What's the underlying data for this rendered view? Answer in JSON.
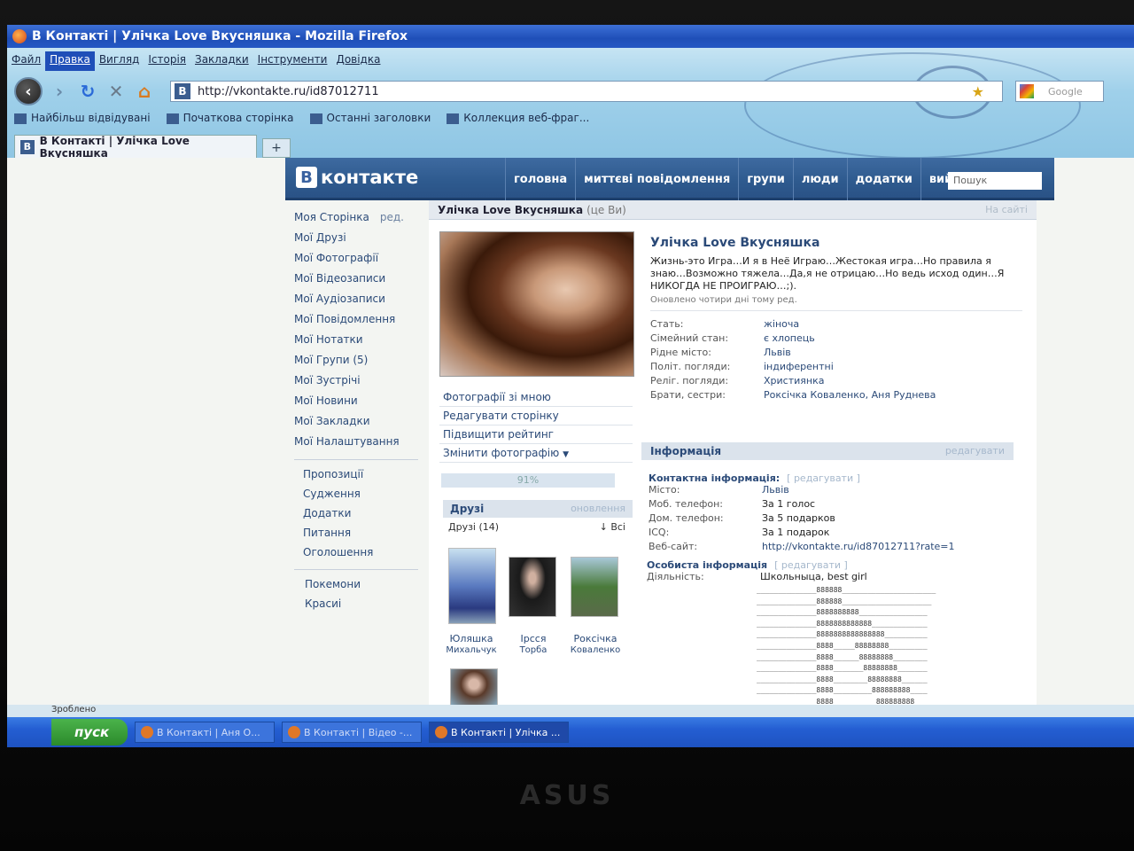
{
  "window": {
    "title": "В Контакті | Улічка Love Вкусняшка - Mozilla Firefox"
  },
  "menu": [
    "Файл",
    "Правка",
    "Вигляд",
    "Історія",
    "Закладки",
    "Інструменти",
    "Довідка"
  ],
  "url": "http://vkontakte.ru/id87012711",
  "search_placeholder": "Google",
  "bookmarks": [
    "Найбільш відвідувані",
    "Початкова сторінка",
    "Останні заголовки",
    "Коллекция веб-фраг..."
  ],
  "tab": {
    "label": "В Контакті | Улічка Love Вкусняшка",
    "new_tab": "+"
  },
  "vk": {
    "logo": "контакте",
    "logo_letter": "В",
    "nav": [
      "головна",
      "миттєві повідомлення",
      "групи",
      "люди",
      "додатки",
      "вийти"
    ],
    "search_placeholder": "Пошук"
  },
  "leftmenu": {
    "my_page": "Моя Сторінка",
    "edit": "ред.",
    "items": [
      "Мої Друзі",
      "Мої Фотографії",
      "Мої Відеозаписи",
      "Мої Аудіозаписи",
      "Мої Повідомлення",
      "Мої Нотатки",
      "Мої Групи (5)",
      "Мої Зустрічі",
      "Мої Новини",
      "Мої Закладки",
      "Мої Налаштування"
    ],
    "items2": [
      "Пропозиції",
      "Судження",
      "Додатки",
      "Питання",
      "Оголошення"
    ],
    "items3": [
      "Покемони",
      "Красиі"
    ]
  },
  "profile": {
    "header_name": "Улічка Love Вкусняшка",
    "header_me": "(це Ви)",
    "online": "На сайті",
    "name": "Улічка Love Вкусняшка",
    "status": "Жизнь-это Игра…И я в Неё Играю…Жестокая игра…Но правила я знаю…Возможно тяжела…Да,я не отрицаю…Но ведь исход один…Я НИКОГДА НЕ ПРОИГРАЮ…;).",
    "updated": "Оновлено чотири дні тому ред.",
    "fields": [
      {
        "k": "Стать:",
        "v": "жіноча"
      },
      {
        "k": "Сімейний стан:",
        "v": "є хлопець"
      },
      {
        "k": "Рідне місто:",
        "v": "Львів"
      },
      {
        "k": "Політ. погляди:",
        "v": "індиферентні"
      },
      {
        "k": "Реліг. погляди:",
        "v": "Християнка"
      },
      {
        "k": "Брати, сестри:",
        "v": "Роксічка Коваленко, Аня Руднева"
      }
    ],
    "links": [
      "Фотографії зі мною",
      "Редагувати сторінку",
      "Підвищити рейтинг",
      "Змінити фотографію"
    ],
    "rating": "91%",
    "friends_title": "Друзі",
    "friends_update": "оновлення",
    "friends_count": "Друзі (14)",
    "friends_all": "↓ Всі",
    "friends": [
      {
        "first": "Юляшка",
        "last": "Михальчук"
      },
      {
        "first": "Ірсся",
        "last": "Торба"
      },
      {
        "first": "Роксічка",
        "last": "Коваленко"
      }
    ],
    "info_title": "Інформація",
    "info_edit": "редагувати",
    "contact_title": "Контактна інформація:",
    "contact_edit": "[ редагувати ]",
    "contact": [
      {
        "k": "Місто:",
        "v": "Львів"
      },
      {
        "k": "Моб. телефон:",
        "v": "За 1 голос"
      },
      {
        "k": "Дом. телефон:",
        "v": "За 5 подарков"
      },
      {
        "k": "ICQ:",
        "v": "За 1 подарок"
      },
      {
        "k": "Веб-сайт:",
        "v": "http://vkontakte.ru/id87012711?rate=1"
      }
    ],
    "personal_title": "Особиста інформація",
    "personal_edit": "[ редагувати ]",
    "activity_k": "Діяльність:",
    "activity_v": "Школьныца, best girl",
    "art": "______________888888______________________\n______________888888_____________________\n______________8888888888________________\n______________8888888888888_____________\n______________8888888888888888__________\n______________8888_____88888888_________\n______________8888______88888888________\n______________8888_______88888888_______\n______________8888________88888888______\n______________8888_________888888888____\n______________8888__________888888888___\n______________8888___________888888888__"
  },
  "status_text": "Зроблено",
  "taskbar": {
    "start": "пуск",
    "buttons": [
      "В Контакті | Аня О...",
      "В Контакті | Відео -...",
      "В Контакті | Улічка ..."
    ]
  },
  "brand": "ASUS"
}
